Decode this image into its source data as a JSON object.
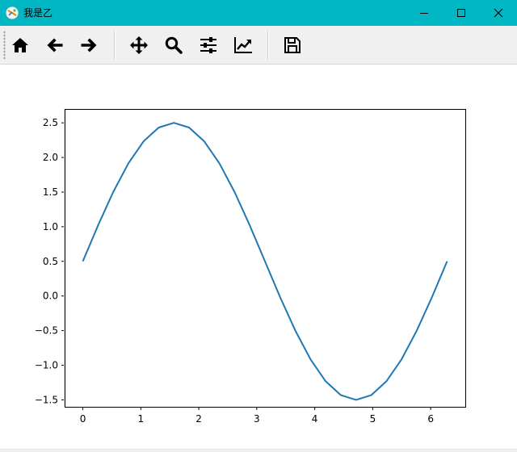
{
  "window": {
    "title": "我是乙",
    "controls": {
      "minimize": "minimize",
      "maximize": "maximize",
      "close": "close"
    }
  },
  "toolbar": {
    "buttons": [
      {
        "name": "home",
        "icon": "home-icon"
      },
      {
        "name": "back",
        "icon": "arrow-left-icon"
      },
      {
        "name": "forward",
        "icon": "arrow-right-icon"
      },
      {
        "name": "pan",
        "icon": "move-icon"
      },
      {
        "name": "zoom",
        "icon": "magnifier-icon"
      },
      {
        "name": "configure-subplots",
        "icon": "sliders-icon"
      },
      {
        "name": "edit-axis",
        "icon": "chart-line-icon"
      },
      {
        "name": "save",
        "icon": "floppy-disk-icon"
      }
    ]
  },
  "chart_data": {
    "type": "line",
    "title": "",
    "xlabel": "",
    "ylabel": "",
    "xlim": [
      -0.314,
      6.597
    ],
    "ylim": [
      -1.6,
      2.7
    ],
    "x_ticks": [
      0,
      1,
      2,
      3,
      4,
      5,
      6
    ],
    "x_tick_labels": [
      "0",
      "1",
      "2",
      "3",
      "4",
      "5",
      "6"
    ],
    "y_ticks": [
      2.5,
      2.0,
      1.5,
      1.0,
      0.5,
      0.0,
      -0.5,
      -1.0,
      -1.5
    ],
    "y_tick_labels": [
      "2.5",
      "2.0",
      "1.5",
      "1.0",
      "0.5",
      "0.0",
      "−0.5",
      "−1.0",
      "−1.5"
    ],
    "series": [
      {
        "color": "#1f77b4",
        "x": [
          0,
          0.2618,
          0.5236,
          0.7854,
          1.0472,
          1.309,
          1.5708,
          1.8326,
          2.0944,
          2.3562,
          2.618,
          2.8798,
          3.1416,
          3.4034,
          3.6652,
          3.927,
          4.1888,
          4.4506,
          4.7124,
          4.9742,
          5.236,
          5.4978,
          5.7596,
          6.0214,
          6.2832
        ],
        "y": [
          0.5,
          1.018,
          1.5,
          1.914,
          2.232,
          2.432,
          2.5,
          2.432,
          2.232,
          1.914,
          1.5,
          1.018,
          0.5,
          -0.018,
          -0.5,
          -0.914,
          -1.232,
          -1.432,
          -1.5,
          -1.432,
          -1.232,
          -0.914,
          -0.5,
          -0.018,
          0.5
        ]
      }
    ],
    "grid": false,
    "highlight_color": "#ffff00"
  }
}
